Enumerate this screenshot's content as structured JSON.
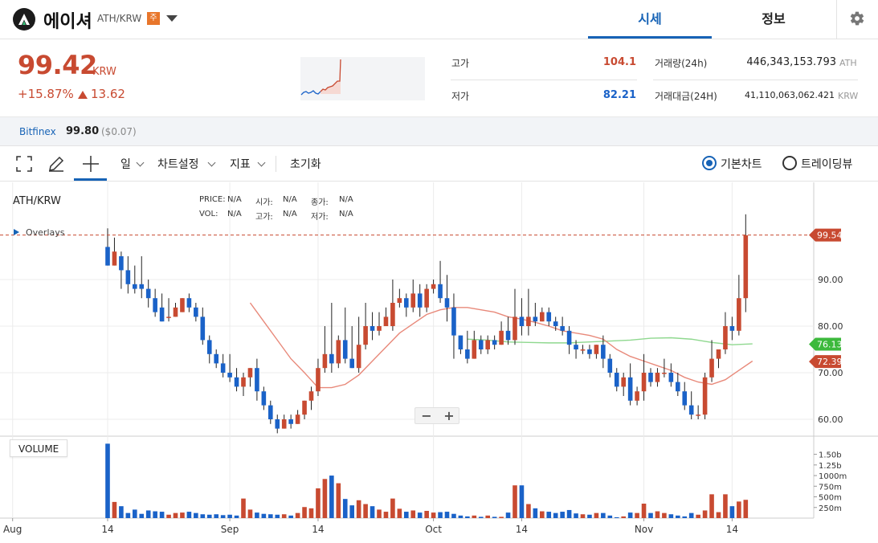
{
  "header": {
    "coin_name": "에이셔",
    "pair": "ATH/KRW",
    "badge": "주",
    "tabs": [
      {
        "label": "시세",
        "active": true
      },
      {
        "label": "정보",
        "active": false
      }
    ]
  },
  "summary": {
    "price": "99.42",
    "unit": "KRW",
    "change_pct": "+15.87%",
    "change_abs": "13.62",
    "high_label": "고가",
    "high_value": "104.1",
    "low_label": "저가",
    "low_value": "82.21",
    "vol_label": "거래량(24h)",
    "vol_value": "446,343,153.793",
    "vol_unit": "ATH",
    "amount_label": "거래대금(24H)",
    "amount_value": "41,110,063,062.421",
    "amount_unit": "KRW"
  },
  "exchange": {
    "name": "Bitfinex",
    "price": "99.80",
    "usd": "($0.07)"
  },
  "toolbar": {
    "interval": "일",
    "chart_settings": "차트설정",
    "indicators": "지표",
    "reset": "초기화",
    "radio_basic": "기본차트",
    "radio_tradingview": "트레이딩뷰"
  },
  "chart_meta": {
    "symbol": "ATH/KRW",
    "overlays": "Overlays",
    "price_lbl": "PRICE:",
    "open_lbl": "시가:",
    "close_lbl": "종가:",
    "vol_lbl": "VOL:",
    "high_lbl": "고가:",
    "low_lbl": "저가:",
    "na": "N/A",
    "volume_label": "VOLUME",
    "zoom_minus": "−",
    "zoom_plus": "+"
  },
  "colors": {
    "up": "#c84a31",
    "down": "#1a62c8",
    "ma_short": "#e8897a",
    "ma_long": "#8fd88f",
    "accent": "#1763b6"
  },
  "chart_data": {
    "type": "candlestick",
    "y_range": [
      56,
      102
    ],
    "y_ticks": [
      "60.00",
      "70.00",
      "80.00",
      "90.00"
    ],
    "x_ticks": [
      {
        "label": "Aug",
        "day": -14
      },
      {
        "label": "14",
        "day": 0
      },
      {
        "label": "Sep",
        "day": 18
      },
      {
        "label": "14",
        "day": 31
      },
      {
        "label": "Oct",
        "day": 48
      },
      {
        "label": "14",
        "day": 61
      },
      {
        "label": "Nov",
        "day": 79
      },
      {
        "label": "14",
        "day": 92
      }
    ],
    "price_tags": [
      {
        "value": 99.54,
        "label": "99.54",
        "color": "#c84a31"
      },
      {
        "value": 76.13,
        "label": "76.13",
        "color": "#3cb93c"
      },
      {
        "value": 72.39,
        "label": "72.39",
        "color": "#c84a31"
      }
    ],
    "volume_ticks": [
      {
        "value": 250,
        "label": "250m"
      },
      {
        "value": 500,
        "label": "500m"
      },
      {
        "value": 750,
        "label": "750m"
      },
      {
        "value": 1000,
        "label": "1000m"
      },
      {
        "value": 1250,
        "label": "1.25b"
      },
      {
        "value": 1500,
        "label": "1.50b"
      }
    ],
    "volume_max": 1700,
    "candles": [
      [
        0,
        97,
        93,
        101,
        93,
        1750
      ],
      [
        1,
        93,
        96,
        99,
        93,
        380
      ],
      [
        2,
        95,
        92,
        96,
        88,
        280
      ],
      [
        3,
        92,
        89,
        95,
        87,
        120
      ],
      [
        4,
        89,
        88,
        93,
        87,
        200
      ],
      [
        5,
        89,
        88,
        95,
        86,
        100
      ],
      [
        6,
        88,
        86,
        90,
        84,
        180
      ],
      [
        7,
        86,
        83,
        88,
        82,
        160
      ],
      [
        8,
        84,
        81,
        87,
        81,
        150
      ],
      [
        9,
        82,
        82,
        86,
        81,
        80
      ],
      [
        10,
        82,
        84,
        85,
        82,
        120
      ],
      [
        11,
        83,
        86,
        86,
        83,
        130
      ],
      [
        12,
        86,
        84,
        87,
        83,
        150
      ],
      [
        13,
        84,
        82,
        85,
        81,
        120
      ],
      [
        14,
        82,
        77,
        84,
        76,
        90
      ],
      [
        15,
        77,
        74,
        78,
        72,
        80
      ],
      [
        16,
        74,
        72,
        75,
        71,
        90
      ],
      [
        17,
        72,
        70,
        74,
        69,
        70
      ],
      [
        18,
        70,
        69,
        74,
        68,
        80
      ],
      [
        19,
        69,
        67,
        71,
        66,
        60
      ],
      [
        20,
        67,
        69,
        70,
        65,
        460
      ],
      [
        21,
        69,
        71,
        71,
        67,
        200
      ],
      [
        22,
        71,
        66,
        73,
        64,
        130
      ],
      [
        23,
        66,
        63,
        67,
        62,
        100
      ],
      [
        24,
        63,
        60,
        64,
        59,
        90
      ],
      [
        25,
        60,
        58,
        61,
        57,
        80
      ],
      [
        26,
        58,
        60,
        61,
        58,
        90
      ],
      [
        27,
        60,
        59,
        61,
        58,
        60
      ],
      [
        28,
        59,
        61,
        62,
        59,
        120
      ],
      [
        29,
        61,
        64,
        64,
        60,
        260
      ],
      [
        30,
        64,
        66,
        67,
        62,
        230
      ],
      [
        31,
        66,
        71,
        73,
        65,
        700
      ],
      [
        32,
        71,
        74,
        80,
        70,
        920
      ],
      [
        33,
        74,
        72,
        85,
        70,
        1000
      ],
      [
        34,
        72,
        77,
        78,
        71,
        820
      ],
      [
        35,
        77,
        73,
        84,
        72,
        450
      ],
      [
        36,
        73,
        71,
        80,
        71,
        300
      ],
      [
        37,
        71,
        76,
        82,
        70,
        420
      ],
      [
        38,
        76,
        80,
        85,
        75,
        330
      ],
      [
        39,
        80,
        79,
        83,
        77,
        280
      ],
      [
        40,
        79,
        80,
        83,
        78,
        200
      ],
      [
        41,
        80,
        82,
        84,
        80,
        150
      ],
      [
        42,
        80,
        85,
        90,
        79,
        460
      ],
      [
        43,
        85,
        86,
        88,
        84,
        220
      ],
      [
        44,
        86,
        84,
        87,
        82,
        150
      ],
      [
        45,
        84,
        87,
        90,
        83,
        180
      ],
      [
        46,
        87,
        84,
        89,
        82,
        130
      ],
      [
        47,
        84,
        88,
        89,
        83,
        170
      ],
      [
        48,
        88,
        89,
        90,
        87,
        130
      ],
      [
        49,
        89,
        86,
        94,
        85,
        140
      ],
      [
        50,
        86,
        84,
        91,
        81,
        150
      ],
      [
        51,
        84,
        78,
        87,
        73,
        100
      ],
      [
        52,
        78,
        75,
        78,
        74,
        60
      ],
      [
        53,
        75,
        73,
        79,
        72,
        40
      ],
      [
        54,
        73,
        77,
        79,
        73,
        60
      ],
      [
        55,
        77,
        75,
        78,
        74,
        30
      ],
      [
        56,
        75,
        77,
        78,
        74,
        60
      ],
      [
        57,
        77,
        76,
        78,
        75,
        30
      ],
      [
        58,
        76,
        79,
        81,
        76,
        30
      ],
      [
        59,
        79,
        77,
        82,
        76,
        130
      ],
      [
        60,
        77,
        82,
        88,
        76,
        770
      ],
      [
        61,
        82,
        80,
        86,
        78,
        770
      ],
      [
        62,
        80,
        82,
        88,
        78,
        330
      ],
      [
        63,
        82,
        81,
        85,
        80,
        230
      ],
      [
        64,
        81,
        83,
        84,
        81,
        160
      ],
      [
        65,
        83,
        81,
        84,
        80,
        150
      ],
      [
        66,
        81,
        80,
        82,
        79,
        120
      ],
      [
        67,
        80,
        79,
        82,
        78,
        150
      ],
      [
        68,
        79,
        76,
        80,
        74,
        190
      ],
      [
        69,
        76,
        75,
        77,
        73,
        110
      ],
      [
        70,
        75,
        75,
        76,
        74,
        90
      ],
      [
        71,
        75,
        74,
        76,
        73,
        80
      ],
      [
        72,
        74,
        76,
        76,
        73,
        120
      ],
      [
        73,
        76,
        73,
        78,
        71,
        120
      ],
      [
        74,
        73,
        70,
        74,
        69,
        60
      ],
      [
        75,
        70,
        67,
        71,
        66,
        20
      ],
      [
        76,
        67,
        69,
        70,
        65,
        40
      ],
      [
        77,
        69,
        64,
        72,
        63,
        130
      ],
      [
        78,
        64,
        66,
        67,
        63,
        120
      ],
      [
        79,
        66,
        70,
        74,
        64,
        340
      ],
      [
        80,
        70,
        68,
        71,
        67,
        120
      ],
      [
        81,
        68,
        70,
        71,
        67,
        160
      ],
      [
        82,
        70,
        70,
        73,
        69,
        120
      ],
      [
        83,
        70,
        68,
        72,
        67,
        90
      ],
      [
        84,
        68,
        66,
        70,
        65,
        60
      ],
      [
        85,
        66,
        63,
        68,
        62,
        40
      ],
      [
        86,
        63,
        61,
        66,
        60,
        120
      ],
      [
        87,
        61,
        61,
        63,
        60,
        80
      ],
      [
        88,
        61,
        69,
        70,
        60,
        180
      ],
      [
        89,
        69,
        73,
        77,
        68,
        560
      ],
      [
        90,
        73,
        75,
        75,
        71,
        140
      ],
      [
        91,
        75,
        80,
        83,
        74,
        560
      ],
      [
        92,
        80,
        79,
        82,
        77,
        280
      ],
      [
        93,
        79,
        86,
        91,
        78,
        390
      ],
      [
        94,
        86,
        99.5,
        104,
        83,
        430
      ]
    ],
    "ma_short": [
      [
        21,
        85
      ],
      [
        23,
        81
      ],
      [
        25,
        77
      ],
      [
        27,
        73
      ],
      [
        29,
        70
      ],
      [
        31,
        66.8
      ],
      [
        33,
        66.8
      ],
      [
        35,
        67.5
      ],
      [
        37,
        69.5
      ],
      [
        39,
        72.5
      ],
      [
        41,
        75.5
      ],
      [
        43,
        78.5
      ],
      [
        45,
        80.5
      ],
      [
        47,
        82.5
      ],
      [
        49,
        83.5
      ],
      [
        51,
        84
      ],
      [
        53,
        84
      ],
      [
        55,
        83.5
      ],
      [
        57,
        83
      ],
      [
        59,
        82
      ],
      [
        61,
        81.5
      ],
      [
        63,
        80.8
      ],
      [
        65,
        80
      ],
      [
        67,
        79
      ],
      [
        69,
        78.5
      ],
      [
        71,
        78
      ],
      [
        73,
        77.2
      ],
      [
        75,
        75
      ],
      [
        77,
        73.5
      ],
      [
        79,
        72.5
      ],
      [
        81,
        71.5
      ],
      [
        83,
        70.5
      ],
      [
        85,
        69
      ],
      [
        87,
        68
      ],
      [
        89,
        67.5
      ],
      [
        91,
        68.5
      ],
      [
        93,
        70.5
      ],
      [
        95,
        72.5
      ]
    ],
    "ma_long": [
      [
        53,
        77.2
      ],
      [
        56,
        77
      ],
      [
        59,
        76.6
      ],
      [
        62,
        76.5
      ],
      [
        65,
        76.4
      ],
      [
        68,
        76.4
      ],
      [
        71,
        76.6
      ],
      [
        74,
        76.8
      ],
      [
        77,
        77
      ],
      [
        80,
        77.4
      ],
      [
        83,
        77.5
      ],
      [
        86,
        77.2
      ],
      [
        89,
        76.5
      ],
      [
        92,
        76
      ],
      [
        95,
        76.2
      ]
    ]
  }
}
